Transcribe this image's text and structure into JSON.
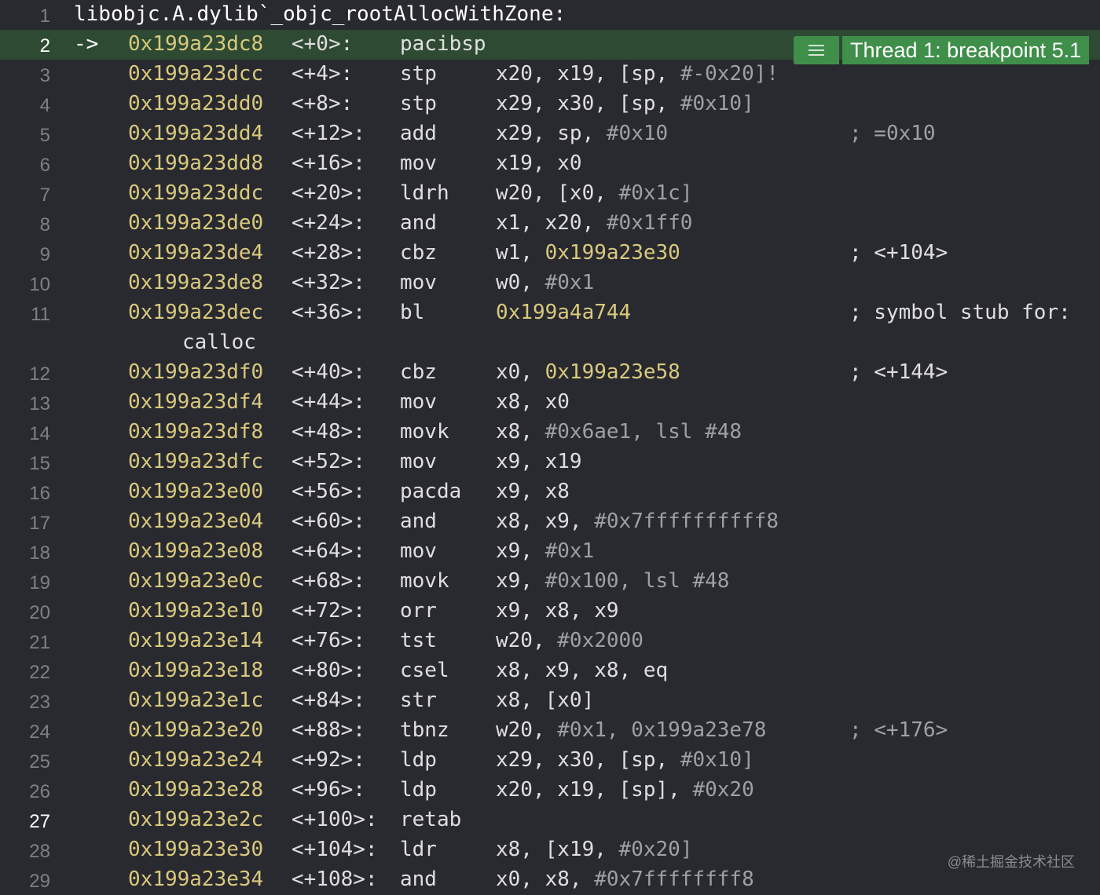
{
  "header": {
    "line_number": "1",
    "symbol": "libobjc.A.dylib`_objc_rootAllocWithZone:"
  },
  "current_pc_arrow": "->",
  "breakpoint_badge": {
    "icon": "list-icon",
    "label": "Thread 1: breakpoint 5.1",
    "color": "#3f8f4a"
  },
  "rows": [
    {
      "ln": "2",
      "addr": "0x199a23dc8",
      "off": "<+0>:",
      "op": "pacibsp",
      "args": [],
      "comment": ""
    },
    {
      "ln": "3",
      "addr": "0x199a23dcc",
      "off": "<+4>:",
      "op": "stp",
      "args": [
        {
          "t": "x20, x19, [sp, ",
          "c": "reg"
        },
        {
          "t": "#-0x20]!",
          "c": "num"
        }
      ],
      "comment": ""
    },
    {
      "ln": "4",
      "addr": "0x199a23dd0",
      "off": "<+8>:",
      "op": "stp",
      "args": [
        {
          "t": "x29, x30, [sp, ",
          "c": "reg"
        },
        {
          "t": "#0x10]",
          "c": "num"
        }
      ],
      "comment": ""
    },
    {
      "ln": "5",
      "addr": "0x199a23dd4",
      "off": "<+12>:",
      "op": "add",
      "args": [
        {
          "t": "x29, sp, ",
          "c": "reg"
        },
        {
          "t": "#0x10",
          "c": "num"
        }
      ],
      "comment": "; =0x10",
      "comment_dim": true
    },
    {
      "ln": "6",
      "addr": "0x199a23dd8",
      "off": "<+16>:",
      "op": "mov",
      "args": [
        {
          "t": "x19, x0",
          "c": "reg"
        }
      ],
      "comment": ""
    },
    {
      "ln": "7",
      "addr": "0x199a23ddc",
      "off": "<+20>:",
      "op": "ldrh",
      "args": [
        {
          "t": "w20, [x0, ",
          "c": "reg"
        },
        {
          "t": "#0x1c]",
          "c": "num"
        }
      ],
      "comment": ""
    },
    {
      "ln": "8",
      "addr": "0x199a23de0",
      "off": "<+24>:",
      "op": "and",
      "args": [
        {
          "t": "x1, x20, ",
          "c": "reg"
        },
        {
          "t": "#0x1ff0",
          "c": "num"
        }
      ],
      "comment": ""
    },
    {
      "ln": "9",
      "addr": "0x199a23de4",
      "off": "<+28>:",
      "op": "cbz",
      "args": [
        {
          "t": "w1, ",
          "c": "reg"
        },
        {
          "t": "0x199a23e30",
          "c": "target"
        }
      ],
      "comment": "; <+104>"
    },
    {
      "ln": "10",
      "addr": "0x199a23de8",
      "off": "<+32>:",
      "op": "mov",
      "args": [
        {
          "t": "w0, ",
          "c": "reg"
        },
        {
          "t": "#0x1",
          "c": "num"
        }
      ],
      "comment": ""
    },
    {
      "ln": "11",
      "addr": "0x199a23dec",
      "off": "<+36>:",
      "op": "bl",
      "args": [
        {
          "t": "0x199a4a744",
          "c": "target"
        }
      ],
      "comment": "; symbol stub for:",
      "wrap": "calloc"
    },
    {
      "ln": "12",
      "addr": "0x199a23df0",
      "off": "<+40>:",
      "op": "cbz",
      "args": [
        {
          "t": "x0, ",
          "c": "reg"
        },
        {
          "t": "0x199a23e58",
          "c": "target"
        }
      ],
      "comment": "; <+144>"
    },
    {
      "ln": "13",
      "addr": "0x199a23df4",
      "off": "<+44>:",
      "op": "mov",
      "args": [
        {
          "t": "x8, x0",
          "c": "reg"
        }
      ],
      "comment": ""
    },
    {
      "ln": "14",
      "addr": "0x199a23df8",
      "off": "<+48>:",
      "op": "movk",
      "args": [
        {
          "t": "x8, ",
          "c": "reg"
        },
        {
          "t": "#0x6ae1, lsl #48",
          "c": "num"
        }
      ],
      "comment": ""
    },
    {
      "ln": "15",
      "addr": "0x199a23dfc",
      "off": "<+52>:",
      "op": "mov",
      "args": [
        {
          "t": "x9, x19",
          "c": "reg"
        }
      ],
      "comment": ""
    },
    {
      "ln": "16",
      "addr": "0x199a23e00",
      "off": "<+56>:",
      "op": "pacda",
      "args": [
        {
          "t": "x9, x8",
          "c": "reg"
        }
      ],
      "comment": ""
    },
    {
      "ln": "17",
      "addr": "0x199a23e04",
      "off": "<+60>:",
      "op": "and",
      "args": [
        {
          "t": "x8, x9, ",
          "c": "reg"
        },
        {
          "t": "#0x7ffffffffff8",
          "c": "num"
        }
      ],
      "comment": ""
    },
    {
      "ln": "18",
      "addr": "0x199a23e08",
      "off": "<+64>:",
      "op": "mov",
      "args": [
        {
          "t": "x9, ",
          "c": "reg"
        },
        {
          "t": "#0x1",
          "c": "num"
        }
      ],
      "comment": ""
    },
    {
      "ln": "19",
      "addr": "0x199a23e0c",
      "off": "<+68>:",
      "op": "movk",
      "args": [
        {
          "t": "x9, ",
          "c": "reg"
        },
        {
          "t": "#0x100, lsl #48",
          "c": "num"
        }
      ],
      "comment": ""
    },
    {
      "ln": "20",
      "addr": "0x199a23e10",
      "off": "<+72>:",
      "op": "orr",
      "args": [
        {
          "t": "x9, x8, x9",
          "c": "reg"
        }
      ],
      "comment": ""
    },
    {
      "ln": "21",
      "addr": "0x199a23e14",
      "off": "<+76>:",
      "op": "tst",
      "args": [
        {
          "t": "w20, ",
          "c": "reg"
        },
        {
          "t": "#0x2000",
          "c": "num"
        }
      ],
      "comment": ""
    },
    {
      "ln": "22",
      "addr": "0x199a23e18",
      "off": "<+80>:",
      "op": "csel",
      "args": [
        {
          "t": "x8, x9, x8, eq",
          "c": "reg"
        }
      ],
      "comment": ""
    },
    {
      "ln": "23",
      "addr": "0x199a23e1c",
      "off": "<+84>:",
      "op": "str",
      "args": [
        {
          "t": "x8, [x0]",
          "c": "reg"
        }
      ],
      "comment": ""
    },
    {
      "ln": "24",
      "addr": "0x199a23e20",
      "off": "<+88>:",
      "op": "tbnz",
      "args": [
        {
          "t": "w20, ",
          "c": "reg"
        },
        {
          "t": "#0x1, 0x199a23e78",
          "c": "num"
        }
      ],
      "comment": "; <+176>",
      "comment_dim": true
    },
    {
      "ln": "25",
      "addr": "0x199a23e24",
      "off": "<+92>:",
      "op": "ldp",
      "args": [
        {
          "t": "x29, x30, [sp, ",
          "c": "reg"
        },
        {
          "t": "#0x10]",
          "c": "num"
        }
      ],
      "comment": ""
    },
    {
      "ln": "26",
      "addr": "0x199a23e28",
      "off": "<+96>:",
      "op": "ldp",
      "args": [
        {
          "t": "x20, x19, [sp], ",
          "c": "reg"
        },
        {
          "t": "#0x20",
          "c": "num"
        }
      ],
      "comment": ""
    },
    {
      "ln": "27",
      "addr": "0x199a23e2c",
      "off": "<+100>:",
      "op": "retab",
      "args": [],
      "comment": "",
      "bright_ln": true
    },
    {
      "ln": "28",
      "addr": "0x199a23e30",
      "off": "<+104>:",
      "op": "ldr",
      "args": [
        {
          "t": "x8, [x19, ",
          "c": "reg"
        },
        {
          "t": "#0x20]",
          "c": "num"
        }
      ],
      "comment": ""
    },
    {
      "ln": "29",
      "addr": "0x199a23e34",
      "off": "<+108>:",
      "op": "and",
      "args": [
        {
          "t": "x0, x8, ",
          "c": "reg"
        },
        {
          "t": "#0x7ffffffff8",
          "c": "num"
        }
      ],
      "comment": ""
    }
  ],
  "watermark": "@稀土掘金技术社区"
}
